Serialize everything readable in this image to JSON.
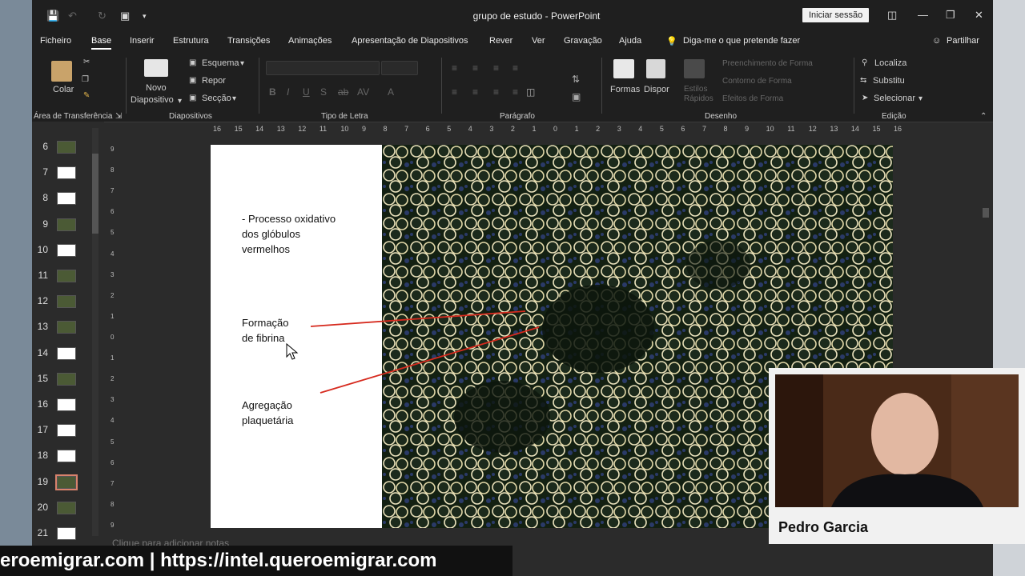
{
  "window": {
    "title": "grupo de estudo  -  PowerPoint",
    "signin": "Iniciar sessão"
  },
  "menu": {
    "tabs": [
      "Ficheiro",
      "Base",
      "Inserir",
      "Estrutura",
      "Transições",
      "Animações",
      "Apresentação de Diapositivos",
      "Rever",
      "Ver",
      "Gravação",
      "Ajuda"
    ],
    "active_tab": "Base",
    "tell_me": "Diga-me o que pretende fazer",
    "share": "Partilhar"
  },
  "ribbon": {
    "paste": "Colar",
    "new_slide_1": "Novo",
    "new_slide_2": "Diapositivo",
    "layout": "Esquema",
    "reset": "Repor",
    "section": "Secção",
    "shapes": "Formas",
    "arrange": "Dispor",
    "find": "Localiza",
    "replace": "Substitu",
    "select": "Selecionar",
    "shape_fill": "Preenchimento de Forma",
    "shape_outline": "Contorno de Forma",
    "shape_effects": "Efeitos de Forma",
    "quick_styles_1": "Estilos",
    "quick_styles_2": "Rápidos",
    "groups": {
      "clipboard": "Área de Transferência",
      "slides": "Diapositivos",
      "font": "Tipo de Letra",
      "paragraph": "Parágrafo",
      "drawing": "Desenho",
      "editing": "Edição"
    }
  },
  "thumbnails": [
    {
      "num": "6",
      "style": "dark"
    },
    {
      "num": "7",
      "style": "white"
    },
    {
      "num": "8",
      "style": "white"
    },
    {
      "num": "9",
      "style": "dark"
    },
    {
      "num": "10",
      "style": "white"
    },
    {
      "num": "11",
      "style": "dark"
    },
    {
      "num": "12",
      "style": "dark"
    },
    {
      "num": "13",
      "style": "dark"
    },
    {
      "num": "14",
      "style": "white"
    },
    {
      "num": "15",
      "style": "dark"
    },
    {
      "num": "16",
      "style": "white"
    },
    {
      "num": "17",
      "style": "white"
    },
    {
      "num": "18",
      "style": "white"
    },
    {
      "num": "19",
      "style": "selected"
    },
    {
      "num": "20",
      "style": "dark"
    },
    {
      "num": "21",
      "style": "white"
    }
  ],
  "ruler": {
    "h_ticks": [
      "16",
      "15",
      "14",
      "13",
      "12",
      "11",
      "10",
      "9",
      "8",
      "7",
      "6",
      "5",
      "4",
      "3",
      "2",
      "1",
      "0",
      "1",
      "2",
      "3",
      "4",
      "5",
      "6",
      "7",
      "8",
      "9",
      "10",
      "11",
      "12",
      "13",
      "14",
      "15",
      "16"
    ],
    "v_ticks": [
      "9",
      "8",
      "7",
      "6",
      "5",
      "4",
      "3",
      "2",
      "1",
      "0",
      "1",
      "2",
      "3",
      "4",
      "5",
      "6",
      "7",
      "8",
      "9"
    ]
  },
  "slide": {
    "text1": [
      "- Processo oxidativo",
      "dos glóbulos",
      "vermelhos"
    ],
    "text2": [
      "Formação",
      "de fibrina"
    ],
    "text3": [
      "Agregação",
      "plaquetária"
    ]
  },
  "notes_placeholder": "Clique para adicionar notas",
  "webcam": {
    "name": "Pedro Garcia"
  },
  "banner": "eroemigrar.com | https://intel.queroemigrar.com",
  "colors": {
    "arrow": "#d62a1e",
    "accent": "#d9826c"
  }
}
